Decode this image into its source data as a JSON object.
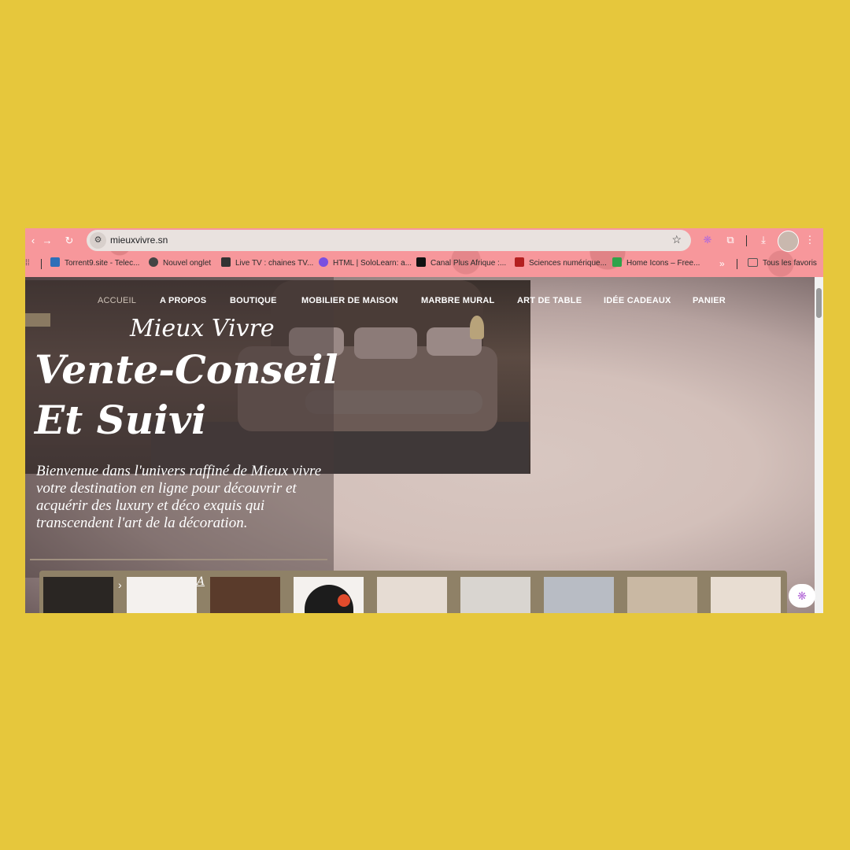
{
  "browser": {
    "url": "mieuxvivre.sn",
    "site_info_icon": "tune-icon",
    "bookmarks": [
      {
        "label": "Torrent9.site - Telec...",
        "icon": "Tg",
        "color": "#2e6fb8"
      },
      {
        "label": "Nouvel onglet",
        "icon": "globe",
        "color": "#444444"
      },
      {
        "label": "Live TV : chaines TV...",
        "icon": "plus",
        "color": "#333333"
      },
      {
        "label": "HTML | SoloLearn: a...",
        "icon": "sololearn",
        "color": "#7a4fe0"
      },
      {
        "label": "Canal Plus Afrique :...",
        "icon": "cross",
        "color": "#111111"
      },
      {
        "label": "Sciences numérique...",
        "icon": "MM",
        "color": "#b32020"
      },
      {
        "label": "Home Icons – Free...",
        "icon": "grid",
        "color": "#2fa34a"
      }
    ],
    "overflow_label": "»",
    "all_bookmarks_label": "Tous les favoris"
  },
  "site": {
    "nav": [
      {
        "label": "ACCUEIL",
        "active": true
      },
      {
        "label": "A PROPOS"
      },
      {
        "label": "BOUTIQUE"
      },
      {
        "label": "MOBILIER DE MAISON"
      },
      {
        "label": "MARBRE MURAL"
      },
      {
        "label": "ART DE TABLE"
      },
      {
        "label": "IDÉE CADEAUX"
      },
      {
        "label": "PANIER"
      }
    ],
    "brand_script": "Mieux Vivre",
    "headline_line1": "Vente-Conseil",
    "headline_line2": "Et Suivi",
    "intro": "Bienvenue dans l'univers raffiné de Mieux vivre votre destination en ligne pour découvrir et acquérir des luxury et déco exquis qui transcendent l'art de la décoration.",
    "thumbnails": [
      {
        "name": "thumb-tableware",
        "color": "#2a2623"
      },
      {
        "name": "thumb-marble-white",
        "color": "#f4f1ee"
      },
      {
        "name": "thumb-candles",
        "color": "#5a3b2b"
      },
      {
        "name": "thumb-black-plate",
        "color": "#f4f1ee"
      },
      {
        "name": "thumb-living-room",
        "color": "#e6dcd3"
      },
      {
        "name": "thumb-decor-leaves",
        "color": "#d9d5d0"
      },
      {
        "name": "thumb-marble-grey",
        "color": "#b8bcc4"
      },
      {
        "name": "thumb-kitchen",
        "color": "#c9b8a3"
      },
      {
        "name": "thumb-closet",
        "color": "#e8ddd2"
      }
    ],
    "thumb_arrow": "›",
    "thumb_letter": "A"
  },
  "colors": {
    "background": "#e6c73c",
    "chrome": "#f7979b",
    "strip": "#8f8167"
  }
}
